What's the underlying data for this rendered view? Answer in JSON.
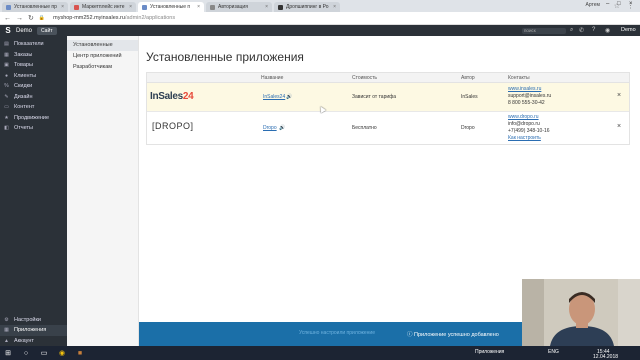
{
  "browser": {
    "tabs": [
      {
        "label": "Установленные пр",
        "active": false,
        "color": "#6b8cc7"
      },
      {
        "label": "Маркетплейс инте",
        "active": false,
        "color": "#d9534f"
      },
      {
        "label": "Установленные п",
        "active": true,
        "color": "#6b8cc7"
      },
      {
        "label": "Авторизация",
        "active": false,
        "color": "#888888"
      },
      {
        "label": "Дропшиппинг в Ро",
        "active": false,
        "color": "#333333"
      }
    ],
    "user_label": "Артем",
    "url_host": "myshop-mm252.myinsales.ru",
    "url_path": "/admin2/applications"
  },
  "topbar": {
    "shop_name": "Demo",
    "site_button": "Сайт",
    "search_placeholder": "поиск",
    "user_name": "Demo"
  },
  "sidebar": {
    "items": [
      {
        "label": "Показатели",
        "icon": "chart-icon"
      },
      {
        "label": "Заказы",
        "icon": "orders-icon"
      },
      {
        "label": "Товары",
        "icon": "products-icon"
      },
      {
        "label": "Клиенты",
        "icon": "clients-icon"
      },
      {
        "label": "Скидки",
        "icon": "discount-icon"
      },
      {
        "label": "Дизайн",
        "icon": "design-icon"
      },
      {
        "label": "Контент",
        "icon": "content-icon"
      },
      {
        "label": "Продвижение",
        "icon": "promo-icon"
      },
      {
        "label": "Отчеты",
        "icon": "reports-icon"
      }
    ],
    "bottom_items": [
      {
        "label": "Настройки",
        "icon": "gear-icon"
      },
      {
        "label": "Приложения",
        "icon": "apps-icon"
      },
      {
        "label": "Аккаунт",
        "icon": "account-icon"
      }
    ]
  },
  "subnav": {
    "items": [
      {
        "label": "Установленные"
      },
      {
        "label": "Центр приложений"
      },
      {
        "label": "Разработчикам"
      }
    ]
  },
  "main": {
    "title": "Установленные приложения",
    "headers": {
      "name": "Название",
      "cost": "Стоимость",
      "author": "Автор",
      "contacts": "Контакты"
    },
    "apps": [
      {
        "logo_text": "InSales",
        "logo_num": "24",
        "name": "InSales24",
        "cost": "Зависит от тарифа",
        "author": "InSales",
        "site": "www.insales.ru",
        "email": "support@insales.ru",
        "phone": "8 800 555-30-42",
        "setup": ""
      },
      {
        "logo_text": "[DROPO]",
        "logo_num": "",
        "name": "Dropo",
        "cost": "Бесплатно",
        "author": "Dropo",
        "site": "www.dropo.ru",
        "email": "info@dropo.ru",
        "phone": "+7(499) 348-10-16",
        "setup": "Как настроить"
      }
    ]
  },
  "notification": {
    "faded": "Успешно настроили приложение",
    "message": "Приложение успешно добавлено"
  },
  "taskbar": {
    "lang": "ENG",
    "apps_label": "Приложения",
    "time": "15:44",
    "date": "12.04.2018"
  }
}
